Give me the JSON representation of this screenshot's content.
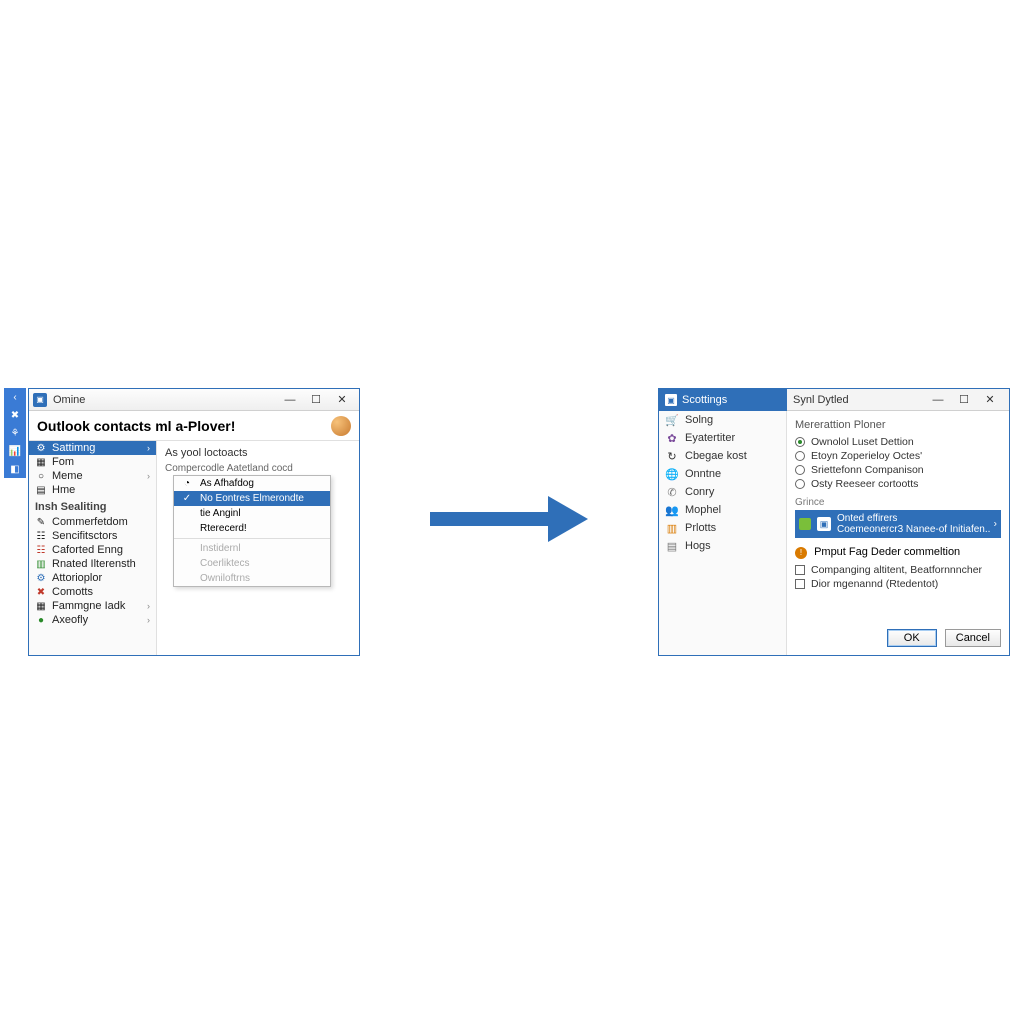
{
  "vtoolbar": [
    "‹",
    "✖",
    "⚘",
    "📊",
    "◧"
  ],
  "win1": {
    "title": "Omine",
    "heading": "Outlook contacts ml a-Plover!",
    "sidebar": {
      "top": [
        {
          "icon": "⚙",
          "label": "Sattimng",
          "selected": true,
          "chev": true
        },
        {
          "icon": "▦",
          "label": "Fom"
        },
        {
          "icon": "○",
          "label": "Meme",
          "chev": true
        },
        {
          "icon": "▤",
          "label": "Hme"
        }
      ],
      "cat": "Insh Sealiting",
      "bottom": [
        {
          "icon": "✎",
          "label": "Commerfetdom"
        },
        {
          "icon": "☷",
          "label": "Sencifitsctors"
        },
        {
          "icon": "☷",
          "label": "Caforted Enng",
          "color": "ic-red"
        },
        {
          "icon": "▥",
          "label": "Rnated Ilterensth",
          "color": "ic-green"
        },
        {
          "icon": "⚙",
          "label": "Attorioplor",
          "color": "ic-blue"
        },
        {
          "icon": "✖",
          "label": "Comotts",
          "color": "ic-red"
        },
        {
          "icon": "▦",
          "label": "Fammgne Iadk",
          "chev": true
        },
        {
          "icon": "●",
          "label": "Axeofly",
          "color": "ic-green",
          "chev": true
        }
      ]
    },
    "content": {
      "header": "As yool loctoacts",
      "sub": "Compercodle Aatetland cocd",
      "menu": [
        {
          "icon": "◔",
          "label": "As Afhafdog"
        },
        {
          "icon": "✓",
          "label": "No Eontres Elmerondte",
          "hl": true
        },
        {
          "icon": "",
          "label": "tie Anginl"
        },
        {
          "icon": "",
          "label": "Rterecerd!"
        },
        {
          "sep": true
        },
        {
          "icon": "",
          "label": "Instidernl",
          "faded": true
        },
        {
          "icon": "",
          "label": "Coerliktecs",
          "faded": true
        },
        {
          "icon": "",
          "label": "Owniloftrns",
          "faded": true
        }
      ]
    }
  },
  "win2": {
    "leftTitle": "Scottings",
    "rightTitle": "Synl Dytled",
    "sidebar": [
      {
        "icon": "🛒",
        "label": "Solng",
        "color": "ic-orange"
      },
      {
        "icon": "✿",
        "label": "Eyatertiter",
        "color": "ic-purple"
      },
      {
        "icon": "↻",
        "label": "Cbegae kost"
      },
      {
        "icon": "🌐",
        "label": "Onntne",
        "color": "ic-blue"
      },
      {
        "icon": "✆",
        "label": "Conry",
        "color": "ic-gray"
      },
      {
        "icon": "👥",
        "label": "Mophel",
        "color": "ic-teal"
      },
      {
        "icon": "▥",
        "label": "Prlotts",
        "color": "ic-orange"
      },
      {
        "icon": "▤",
        "label": "Hogs",
        "color": "ic-gray"
      }
    ],
    "panel": {
      "group1": "Mererattion Ploner",
      "radios": [
        {
          "on": true,
          "label": "Ownolol Luset Dettion"
        },
        {
          "on": false,
          "label": "Etoyn Zoperieloy Octes'"
        },
        {
          "on": false,
          "label": "Sriettefonn Companison"
        },
        {
          "on": false,
          "label": "Osty Reeseer cortootts"
        }
      ],
      "sect": "Grince",
      "hl": {
        "line1": "Onted effirers",
        "line2": "Coemeonercr3 Nanee-of Initiafen.."
      },
      "info": "Pmput Fag Deder commeltion",
      "checks": [
        {
          "label": "Companging altitent, Beatfornnncher"
        },
        {
          "label": "Dior mgenannd (Rtedentot)"
        }
      ],
      "ok": "OK",
      "cancel": "Cancel"
    }
  }
}
